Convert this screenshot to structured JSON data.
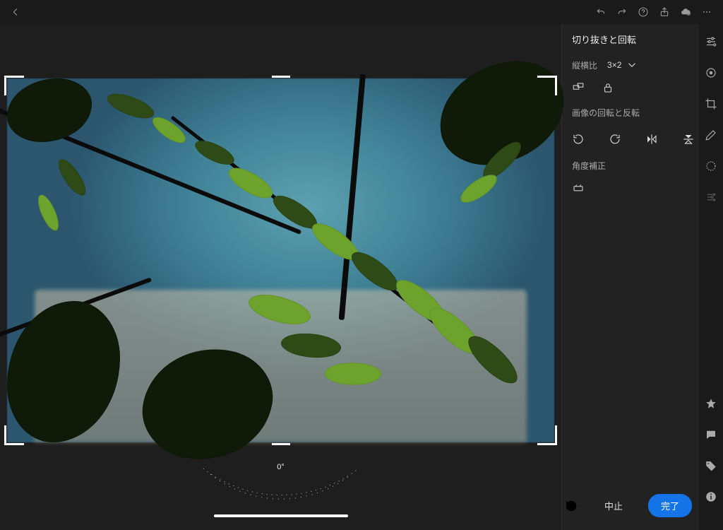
{
  "panel": {
    "title": "切り抜きと回転",
    "aspect": {
      "label": "縦横比",
      "value": "3×2"
    },
    "rotate_section": "画像の回転と反転",
    "straighten_section": "角度補正"
  },
  "angle": {
    "value": "0°"
  },
  "actions": {
    "cancel": "中止",
    "done": "完了"
  }
}
